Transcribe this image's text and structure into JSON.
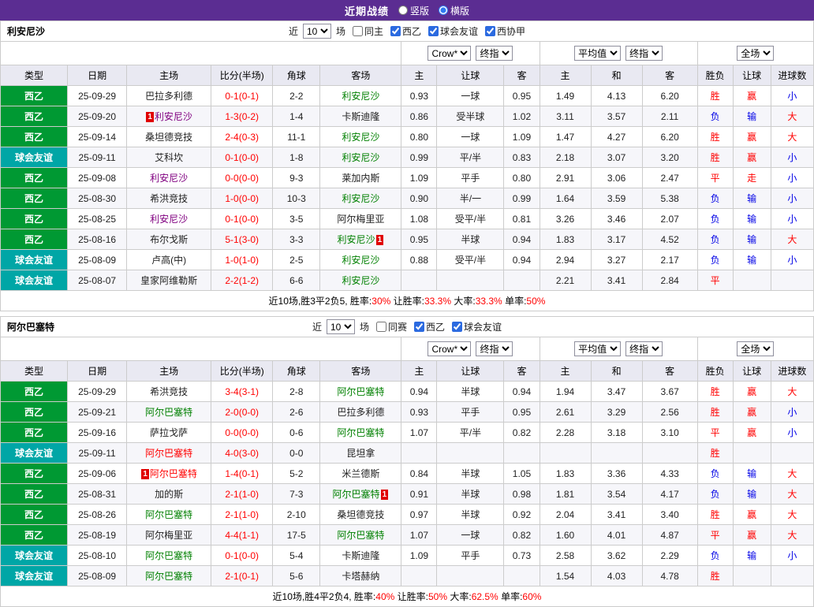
{
  "topbar": {
    "title": "近期战绩",
    "radios": [
      {
        "label": "竖版",
        "selected": false
      },
      {
        "label": "横版",
        "selected": true
      }
    ]
  },
  "columns": [
    "类型",
    "日期",
    "主场",
    "比分(半场)",
    "角球",
    "客场",
    "主",
    "让球",
    "客",
    "主",
    "和",
    "客",
    "胜负",
    "让球",
    "进球数"
  ],
  "controls": {
    "near_prefix": "近",
    "near_suffix": "场",
    "asian_company": "Crow*",
    "asian_type": "终指",
    "euro_company": "平均值",
    "euro_type": "终指",
    "scope": "全场"
  },
  "red_card_badge": "1",
  "league_colors": {
    "西乙": "#009933",
    "球会友谊": "#00a6a6"
  },
  "text_colors": {
    "red": "#ff0000",
    "blue": "#0000e6",
    "green": "#008000",
    "purple": "#800080"
  },
  "sections": [
    {
      "team": "利安尼沙",
      "near_value": "10",
      "checkboxes": [
        {
          "label": "同主",
          "checked": false
        },
        {
          "label": "西乙",
          "checked": true
        },
        {
          "label": "球会友谊",
          "checked": true
        },
        {
          "label": "西协甲",
          "checked": true
        }
      ],
      "rows": [
        {
          "league": "西乙",
          "date": "25-09-29",
          "home": {
            "name": "巴拉多利德",
            "color": "black"
          },
          "score": "0-1(0-1)",
          "corner": "2-2",
          "away": {
            "name": "利安尼沙",
            "color": "green"
          },
          "asian": [
            "0.93",
            "一球",
            "0.95"
          ],
          "euro": [
            "1.49",
            "4.13",
            "6.20"
          ],
          "res": [
            [
              "胜",
              "red"
            ],
            [
              "赢",
              "red"
            ],
            [
              "小",
              "blue"
            ]
          ]
        },
        {
          "league": "西乙",
          "date": "25-09-20",
          "home": {
            "name": "利安尼沙",
            "color": "purple",
            "badge": "before"
          },
          "score": "1-3(0-2)",
          "corner": "1-4",
          "away": {
            "name": "卡斯迪隆",
            "color": "black"
          },
          "asian": [
            "0.86",
            "受半球",
            "1.02"
          ],
          "euro": [
            "3.11",
            "3.57",
            "2.11"
          ],
          "res": [
            [
              "负",
              "blue"
            ],
            [
              "输",
              "blue"
            ],
            [
              "大",
              "red"
            ]
          ]
        },
        {
          "league": "西乙",
          "date": "25-09-14",
          "home": {
            "name": "桑坦德竞技",
            "color": "black"
          },
          "score": "2-4(0-3)",
          "corner": "11-1",
          "away": {
            "name": "利安尼沙",
            "color": "green"
          },
          "asian": [
            "0.80",
            "一球",
            "1.09"
          ],
          "euro": [
            "1.47",
            "4.27",
            "6.20"
          ],
          "res": [
            [
              "胜",
              "red"
            ],
            [
              "赢",
              "red"
            ],
            [
              "大",
              "red"
            ]
          ]
        },
        {
          "league": "球会友谊",
          "date": "25-09-11",
          "home": {
            "name": "艾科坎",
            "color": "black"
          },
          "score": "0-1(0-0)",
          "corner": "1-8",
          "away": {
            "name": "利安尼沙",
            "color": "green"
          },
          "asian": [
            "0.99",
            "平/半",
            "0.83"
          ],
          "euro": [
            "2.18",
            "3.07",
            "3.20"
          ],
          "res": [
            [
              "胜",
              "red"
            ],
            [
              "赢",
              "red"
            ],
            [
              "小",
              "blue"
            ]
          ]
        },
        {
          "league": "西乙",
          "date": "25-09-08",
          "home": {
            "name": "利安尼沙",
            "color": "purple"
          },
          "score": "0-0(0-0)",
          "corner": "9-3",
          "away": {
            "name": "莱加内斯",
            "color": "black"
          },
          "asian": [
            "1.09",
            "平手",
            "0.80"
          ],
          "euro": [
            "2.91",
            "3.06",
            "2.47"
          ],
          "res": [
            [
              "平",
              "red"
            ],
            [
              "走",
              "red"
            ],
            [
              "小",
              "blue"
            ]
          ]
        },
        {
          "league": "西乙",
          "date": "25-08-30",
          "home": {
            "name": "希洪竞技",
            "color": "black"
          },
          "score": "1-0(0-0)",
          "corner": "10-3",
          "away": {
            "name": "利安尼沙",
            "color": "green"
          },
          "asian": [
            "0.90",
            "半/一",
            "0.99"
          ],
          "euro": [
            "1.64",
            "3.59",
            "5.38"
          ],
          "res": [
            [
              "负",
              "blue"
            ],
            [
              "输",
              "blue"
            ],
            [
              "小",
              "blue"
            ]
          ]
        },
        {
          "league": "西乙",
          "date": "25-08-25",
          "home": {
            "name": "利安尼沙",
            "color": "purple"
          },
          "score": "0-1(0-0)",
          "corner": "3-5",
          "away": {
            "name": "阿尔梅里亚",
            "color": "black"
          },
          "asian": [
            "1.08",
            "受平/半",
            "0.81"
          ],
          "euro": [
            "3.26",
            "3.46",
            "2.07"
          ],
          "res": [
            [
              "负",
              "blue"
            ],
            [
              "输",
              "blue"
            ],
            [
              "小",
              "blue"
            ]
          ]
        },
        {
          "league": "西乙",
          "date": "25-08-16",
          "home": {
            "name": "布尔戈斯",
            "color": "black"
          },
          "score": "5-1(3-0)",
          "corner": "3-3",
          "away": {
            "name": "利安尼沙",
            "color": "green",
            "badge": "after"
          },
          "asian": [
            "0.95",
            "半球",
            "0.94"
          ],
          "euro": [
            "1.83",
            "3.17",
            "4.52"
          ],
          "res": [
            [
              "负",
              "blue"
            ],
            [
              "输",
              "blue"
            ],
            [
              "大",
              "red"
            ]
          ]
        },
        {
          "league": "球会友谊",
          "date": "25-08-09",
          "home": {
            "name": "卢高(中)",
            "color": "black"
          },
          "score": "1-0(1-0)",
          "corner": "2-5",
          "away": {
            "name": "利安尼沙",
            "color": "green"
          },
          "asian": [
            "0.88",
            "受平/半",
            "0.94"
          ],
          "euro": [
            "2.94",
            "3.27",
            "2.17"
          ],
          "res": [
            [
              "负",
              "blue"
            ],
            [
              "输",
              "blue"
            ],
            [
              "小",
              "blue"
            ]
          ]
        },
        {
          "league": "球会友谊",
          "date": "25-08-07",
          "home": {
            "name": "皇家阿维勒斯",
            "color": "black"
          },
          "score": "2-2(1-2)",
          "corner": "6-6",
          "away": {
            "name": "利安尼沙",
            "color": "green"
          },
          "asian": [
            "",
            "",
            ""
          ],
          "euro": [
            "2.21",
            "3.41",
            "2.84"
          ],
          "res": [
            [
              "平",
              "red"
            ],
            [
              "",
              ""
            ],
            [
              "",
              ""
            ]
          ]
        }
      ],
      "summary": {
        "prefix": "近10场,胜3平2负5, ",
        "stats": [
          {
            "label": "胜率:",
            "value": "30%"
          },
          {
            "label": "让胜率:",
            "value": "33.3%"
          },
          {
            "label": "大率:",
            "value": "33.3%"
          },
          {
            "label": "单率:",
            "value": "50%"
          }
        ]
      }
    },
    {
      "team": "阿尔巴塞特",
      "near_value": "10",
      "checkboxes": [
        {
          "label": "同赛",
          "checked": false
        },
        {
          "label": "西乙",
          "checked": true
        },
        {
          "label": "球会友谊",
          "checked": true
        }
      ],
      "rows": [
        {
          "league": "西乙",
          "date": "25-09-29",
          "home": {
            "name": "希洪竞技",
            "color": "black"
          },
          "score": "3-4(3-1)",
          "corner": "2-8",
          "away": {
            "name": "阿尔巴塞特",
            "color": "green"
          },
          "asian": [
            "0.94",
            "半球",
            "0.94"
          ],
          "euro": [
            "1.94",
            "3.47",
            "3.67"
          ],
          "res": [
            [
              "胜",
              "red"
            ],
            [
              "赢",
              "red"
            ],
            [
              "大",
              "red"
            ]
          ]
        },
        {
          "league": "西乙",
          "date": "25-09-21",
          "home": {
            "name": "阿尔巴塞特",
            "color": "green"
          },
          "score": "2-0(0-0)",
          "corner": "2-6",
          "away": {
            "name": "巴拉多利德",
            "color": "black"
          },
          "asian": [
            "0.93",
            "平手",
            "0.95"
          ],
          "euro": [
            "2.61",
            "3.29",
            "2.56"
          ],
          "res": [
            [
              "胜",
              "red"
            ],
            [
              "赢",
              "red"
            ],
            [
              "小",
              "blue"
            ]
          ]
        },
        {
          "league": "西乙",
          "date": "25-09-16",
          "home": {
            "name": "萨拉戈萨",
            "color": "black"
          },
          "score": "0-0(0-0)",
          "corner": "0-6",
          "away": {
            "name": "阿尔巴塞特",
            "color": "green"
          },
          "asian": [
            "1.07",
            "平/半",
            "0.82"
          ],
          "euro": [
            "2.28",
            "3.18",
            "3.10"
          ],
          "res": [
            [
              "平",
              "red"
            ],
            [
              "赢",
              "red"
            ],
            [
              "小",
              "blue"
            ]
          ]
        },
        {
          "league": "球会友谊",
          "date": "25-09-11",
          "home": {
            "name": "阿尔巴塞特",
            "color": "red"
          },
          "score": "4-0(3-0)",
          "corner": "0-0",
          "away": {
            "name": "昆坦拿",
            "color": "black"
          },
          "asian": [
            "",
            "",
            ""
          ],
          "euro": [
            "",
            "",
            ""
          ],
          "res": [
            [
              "胜",
              "red"
            ],
            [
              "",
              ""
            ],
            [
              "",
              ""
            ]
          ]
        },
        {
          "league": "西乙",
          "date": "25-09-06",
          "home": {
            "name": "阿尔巴塞特",
            "color": "red",
            "badge": "before"
          },
          "score": "1-4(0-1)",
          "corner": "5-2",
          "away": {
            "name": "米兰德斯",
            "color": "black"
          },
          "asian": [
            "0.84",
            "半球",
            "1.05"
          ],
          "euro": [
            "1.83",
            "3.36",
            "4.33"
          ],
          "res": [
            [
              "负",
              "blue"
            ],
            [
              "输",
              "blue"
            ],
            [
              "大",
              "red"
            ]
          ]
        },
        {
          "league": "西乙",
          "date": "25-08-31",
          "home": {
            "name": "加的斯",
            "color": "black"
          },
          "score": "2-1(1-0)",
          "corner": "7-3",
          "away": {
            "name": "阿尔巴塞特",
            "color": "green",
            "badge": "after"
          },
          "asian": [
            "0.91",
            "半球",
            "0.98"
          ],
          "euro": [
            "1.81",
            "3.54",
            "4.17"
          ],
          "res": [
            [
              "负",
              "blue"
            ],
            [
              "输",
              "blue"
            ],
            [
              "大",
              "red"
            ]
          ]
        },
        {
          "league": "西乙",
          "date": "25-08-26",
          "home": {
            "name": "阿尔巴塞特",
            "color": "green"
          },
          "score": "2-1(1-0)",
          "corner": "2-10",
          "away": {
            "name": "桑坦德竞技",
            "color": "black"
          },
          "asian": [
            "0.97",
            "半球",
            "0.92"
          ],
          "euro": [
            "2.04",
            "3.41",
            "3.40"
          ],
          "res": [
            [
              "胜",
              "red"
            ],
            [
              "赢",
              "red"
            ],
            [
              "大",
              "red"
            ]
          ]
        },
        {
          "league": "西乙",
          "date": "25-08-19",
          "home": {
            "name": "阿尔梅里亚",
            "color": "black"
          },
          "score": "4-4(1-1)",
          "corner": "17-5",
          "away": {
            "name": "阿尔巴塞特",
            "color": "green"
          },
          "asian": [
            "1.07",
            "一球",
            "0.82"
          ],
          "euro": [
            "1.60",
            "4.01",
            "4.87"
          ],
          "res": [
            [
              "平",
              "red"
            ],
            [
              "赢",
              "red"
            ],
            [
              "大",
              "red"
            ]
          ]
        },
        {
          "league": "球会友谊",
          "date": "25-08-10",
          "home": {
            "name": "阿尔巴塞特",
            "color": "green"
          },
          "score": "0-1(0-0)",
          "corner": "5-4",
          "away": {
            "name": "卡斯迪隆",
            "color": "black"
          },
          "asian": [
            "1.09",
            "平手",
            "0.73"
          ],
          "euro": [
            "2.58",
            "3.62",
            "2.29"
          ],
          "res": [
            [
              "负",
              "blue"
            ],
            [
              "输",
              "blue"
            ],
            [
              "小",
              "blue"
            ]
          ]
        },
        {
          "league": "球会友谊",
          "date": "25-08-09",
          "home": {
            "name": "阿尔巴塞特",
            "color": "green"
          },
          "score": "2-1(0-1)",
          "corner": "5-6",
          "away": {
            "name": "卡塔赫纳",
            "color": "black"
          },
          "asian": [
            "",
            "",
            ""
          ],
          "euro": [
            "1.54",
            "4.03",
            "4.78"
          ],
          "res": [
            [
              "胜",
              "red"
            ],
            [
              "",
              ""
            ],
            [
              "",
              ""
            ]
          ]
        }
      ],
      "summary": {
        "prefix": "近10场,胜4平2负4, ",
        "stats": [
          {
            "label": "胜率:",
            "value": "40%"
          },
          {
            "label": "让胜率:",
            "value": "50%"
          },
          {
            "label": "大率:",
            "value": "62.5%"
          },
          {
            "label": "单率:",
            "value": "60%"
          }
        ]
      }
    }
  ]
}
